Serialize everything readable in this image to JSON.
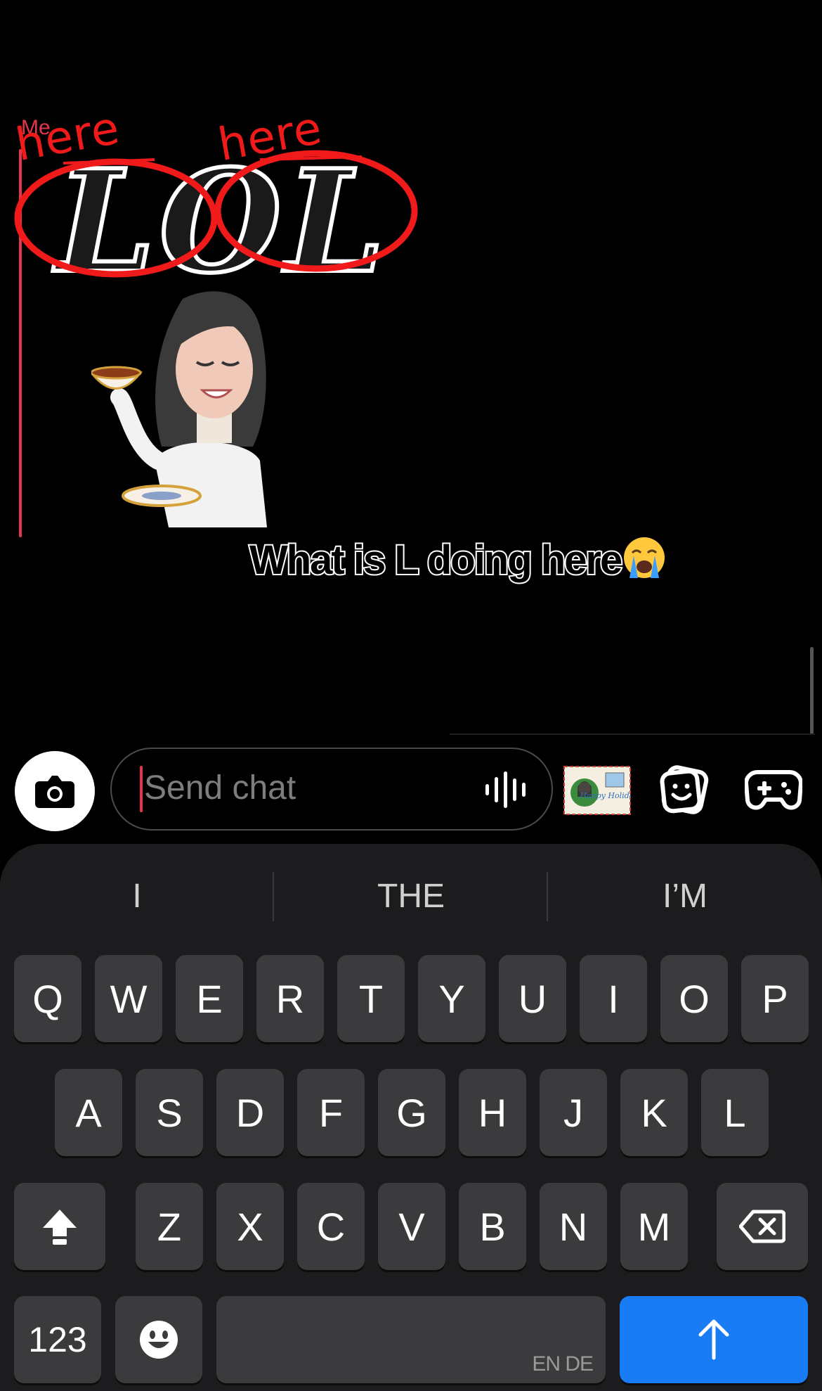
{
  "chat": {
    "sender": "Me",
    "annotation_left": "here",
    "annotation_right": "here",
    "sticker_text": "LOL",
    "caption": "What is L doing here",
    "caption_emoji": "loudly-crying-face",
    "colors": {
      "sender_accent": "#e2374a",
      "annotation": "#f01a1a"
    }
  },
  "input": {
    "placeholder": "Send chat",
    "camera_icon": "camera-icon",
    "voice_icon": "voice-waveform-icon",
    "postcard_text": "Happy Holidays!",
    "memories_icon": "memories-icon",
    "games_icon": "game-controller-icon"
  },
  "keyboard": {
    "suggestions": [
      "I",
      "THE",
      "I’M"
    ],
    "row1": [
      "Q",
      "W",
      "E",
      "R",
      "T",
      "Y",
      "U",
      "I",
      "O",
      "P"
    ],
    "row2": [
      "A",
      "S",
      "D",
      "F",
      "G",
      "H",
      "J",
      "K",
      "L"
    ],
    "row3": [
      "Z",
      "X",
      "C",
      "V",
      "B",
      "N",
      "M"
    ],
    "numbers_key": "123",
    "language_label": "EN DE",
    "shift_icon": "shift-icon",
    "backspace_icon": "backspace-icon",
    "emoji_icon": "emoji-icon",
    "return_icon": "send-arrow-icon",
    "colors": {
      "key": "#3b3b3d",
      "background": "#1c1c1e",
      "return": "#1a7cf5"
    }
  }
}
